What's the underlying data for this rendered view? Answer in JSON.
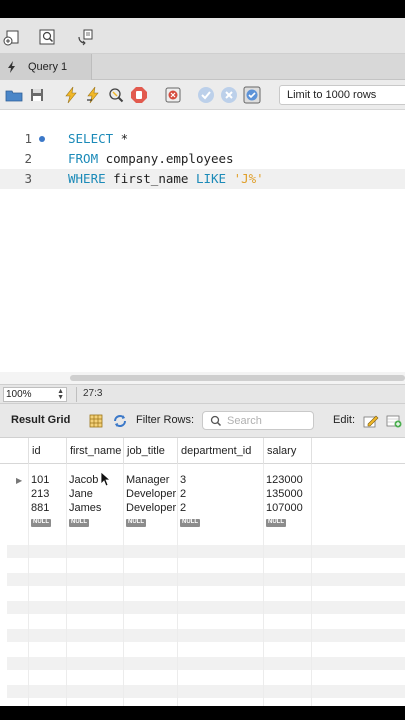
{
  "tab": {
    "label": "Query 1"
  },
  "editor_toolbar": {
    "limit_label": "Limit to 1000 rows"
  },
  "editor": {
    "lines": [
      {
        "number": "1",
        "keyword": "SELECT",
        "rest": " *",
        "string": ""
      },
      {
        "number": "2",
        "keyword": "FROM",
        "rest": " company.employees",
        "string": ""
      },
      {
        "number": "3",
        "keyword": "WHERE",
        "rest": " first_name ",
        "keyword2": "LIKE",
        "string": " 'J%'"
      }
    ]
  },
  "status_bar": {
    "zoom": "100%",
    "cursor_position": "27:3"
  },
  "result_header": {
    "title": "Result Grid",
    "filter_label": "Filter Rows:",
    "search_placeholder": "Search",
    "edit_label": "Edit:"
  },
  "grid": {
    "columns": [
      "id",
      "first_name",
      "job_title",
      "department_id",
      "salary"
    ],
    "rows": [
      [
        "101",
        "Jacob",
        "Manager",
        "3",
        "123000"
      ],
      [
        "213",
        "Jane",
        "Developer",
        "2",
        "135000"
      ],
      [
        "881",
        "James",
        "Developer",
        "2",
        "107000"
      ]
    ],
    "null_label": "NULL"
  },
  "colors": {
    "keyword": "#1b8ab8",
    "string": "#e0a02c",
    "accent": "#3b78c8"
  }
}
